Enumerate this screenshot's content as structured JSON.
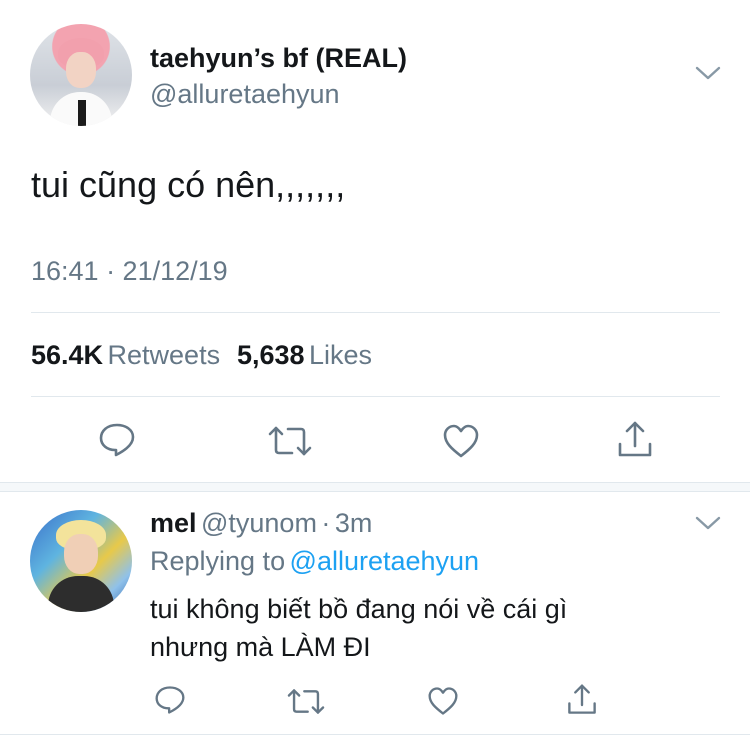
{
  "tweet": {
    "display_name": "taehyun’s bf (REAL)",
    "handle": "@alluretaehyun",
    "text": "tui cũng có nên,,,,,,,",
    "timestamp": "16:41 · 21/12/19",
    "retweets_count": "56.4K",
    "retweets_label": "Retweets",
    "likes_count": "5,638",
    "likes_label": "Likes"
  },
  "reply": {
    "display_name": "mel",
    "handle": "@tyunom",
    "separator": "·",
    "time": "3m",
    "replying_prefix": "Replying to",
    "replying_handle": "@alluretaehyun",
    "text_line1": "tui không biết bồ đang nói về cái gì",
    "text_line2": "nhưng mà LÀM ĐI"
  },
  "icons": {
    "reply": "reply-icon",
    "retweet": "retweet-icon",
    "like": "heart-icon",
    "share": "share-icon",
    "more": "chevron-down-icon"
  },
  "colors": {
    "text": "#14171a",
    "secondary": "#657786",
    "link": "#1da1f2",
    "divider": "#e1e8ed"
  }
}
